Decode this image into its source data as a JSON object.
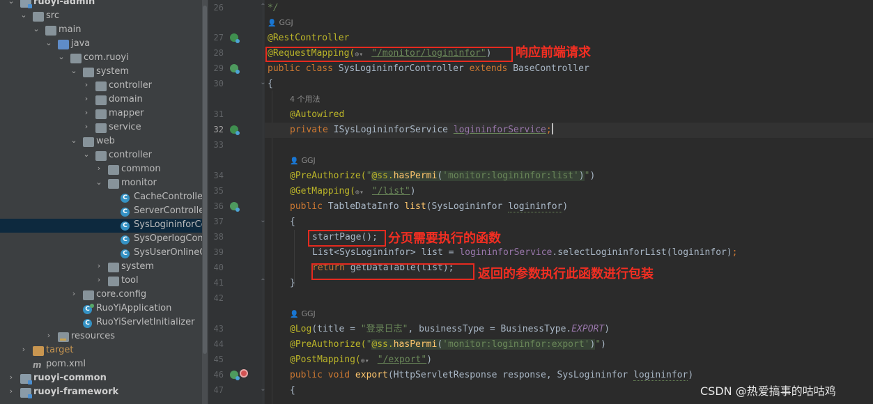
{
  "project_tree": {
    "rows": [
      {
        "label": "ruoyi-admin",
        "arrow": "expanded",
        "icon": "module-folder-icon",
        "bold": true
      },
      {
        "label": "src",
        "arrow": "expanded",
        "icon": "folder-icon"
      },
      {
        "label": "main",
        "arrow": "expanded",
        "icon": "folder-icon"
      },
      {
        "label": "java",
        "arrow": "expanded",
        "icon": "source-folder-icon"
      },
      {
        "label": "com.ruoyi",
        "arrow": "expanded",
        "icon": "package-icon"
      },
      {
        "label": "system",
        "arrow": "expanded",
        "icon": "package-icon"
      },
      {
        "label": "controller",
        "arrow": "collapsed",
        "icon": "package-icon"
      },
      {
        "label": "domain",
        "arrow": "collapsed",
        "icon": "package-icon"
      },
      {
        "label": "mapper",
        "arrow": "collapsed",
        "icon": "package-icon"
      },
      {
        "label": "service",
        "arrow": "collapsed",
        "icon": "package-icon"
      },
      {
        "label": "web",
        "arrow": "expanded",
        "icon": "package-icon"
      },
      {
        "label": "controller",
        "arrow": "expanded",
        "icon": "package-icon"
      },
      {
        "label": "common",
        "arrow": "collapsed",
        "icon": "package-icon"
      },
      {
        "label": "monitor",
        "arrow": "expanded",
        "icon": "package-icon"
      },
      {
        "label": "CacheController",
        "arrow": "none",
        "icon": "java-class-icon"
      },
      {
        "label": "ServerController",
        "arrow": "none",
        "icon": "java-class-icon"
      },
      {
        "label": "SysLogininforController",
        "arrow": "none",
        "icon": "java-class-icon",
        "selected": true
      },
      {
        "label": "SysOperlogController",
        "arrow": "none",
        "icon": "java-class-icon"
      },
      {
        "label": "SysUserOnlineController",
        "arrow": "none",
        "icon": "java-class-icon"
      },
      {
        "label": "system",
        "arrow": "collapsed",
        "icon": "package-icon"
      },
      {
        "label": "tool",
        "arrow": "collapsed",
        "icon": "package-icon"
      },
      {
        "label": "core.config",
        "arrow": "collapsed",
        "icon": "package-icon"
      },
      {
        "label": "RuoYiApplication",
        "arrow": "none",
        "icon": "spring-app-class-icon"
      },
      {
        "label": "RuoYiServletInitializer",
        "arrow": "none",
        "icon": "java-class-icon"
      },
      {
        "label": "resources",
        "arrow": "collapsed",
        "icon": "resources-folder-icon"
      },
      {
        "label": "target",
        "arrow": "collapsed",
        "icon": "excluded-folder-icon",
        "target": true
      },
      {
        "label": "pom.xml",
        "arrow": "none",
        "icon": "maven-icon"
      },
      {
        "label": "ruoyi-common",
        "arrow": "collapsed",
        "icon": "module-folder-icon",
        "bold": true
      },
      {
        "label": "ruoyi-framework",
        "arrow": "collapsed",
        "icon": "module-folder-icon",
        "bold": true
      }
    ]
  },
  "editor": {
    "line_numbers": [
      "26",
      "27",
      "28",
      "29",
      "30",
      "31",
      "32",
      "33",
      "34",
      "35",
      "36",
      "37",
      "38",
      "39",
      "40",
      "41",
      "42",
      "43",
      "44",
      "45",
      "46",
      "47"
    ],
    "current_line": "32",
    "hints": {
      "author": "GGJ",
      "usages": "4 个用法"
    },
    "code": {
      "l26": "*/",
      "l27_ann": "@RestController",
      "l28_ann": "@RequestMapping(",
      "l28_url": "\"/monitor/logininfor\"",
      "l28_close": ")",
      "l29_kw": "public class ",
      "l29_name": "SysLogininforController ",
      "l29_kw2": "extends ",
      "l29_base": "BaseController",
      "l30": "{",
      "l31_ann": "@Autowired",
      "l32_kw": "private ",
      "l32_type": "ISysLogininforService ",
      "l32_fld": "logininforService",
      "l32_semi": ";",
      "l34_ann": "@PreAuthorize(",
      "l34_q1": "\"",
      "l34_inj1": "@ss.",
      "l34_inj2": "hasPermi",
      "l34_inj3": "(",
      "l34_inj4": "'monitor:logininfor:list'",
      "l34_inj5": ")",
      "l34_q2": "\"",
      "l34_close": ")",
      "l35_ann": "@GetMapping(",
      "l35_url": "\"/list\"",
      "l35_close": ")",
      "l36_kw": "public ",
      "l36_type": "TableDataInfo ",
      "l36_fn": "list",
      "l36_args": "(SysLogininfor ",
      "l36_param": "logininfor",
      "l36_close": ")",
      "l37": "{",
      "l38": "startPage();",
      "l39_a": "List<SysLogininfor> list = ",
      "l39_fld": "logininforService",
      "l39_b": ".selectLogininforList(logininfor)",
      "l39_semi": ";",
      "l40_kw": "return ",
      "l40_rest": "getDataTable(list);",
      "l41": "}",
      "l43_ann": "@Log",
      "l43_a": "(title = ",
      "l43_str": "\"登录日志\"",
      "l43_b": ", businessType = BusinessType.",
      "l43_enum": "EXPORT",
      "l43_close": ")",
      "l44_ann": "@PreAuthorize(",
      "l44_q1": "\"",
      "l44_inj1": "@ss.",
      "l44_inj2": "hasPermi",
      "l44_inj3": "(",
      "l44_inj4": "'monitor:logininfor:export'",
      "l44_inj5": ")",
      "l44_q2": "\"",
      "l44_close": ")",
      "l45_ann": "@PostMapping(",
      "l45_url": "\"/export\"",
      "l45_close": ")",
      "l46_kw": "public void ",
      "l46_fn": "export",
      "l46_args": "(HttpServletResponse response, SysLogininfor ",
      "l46_param": "logininfor",
      "l46_close": ")",
      "l47": "{"
    }
  },
  "annotations": {
    "request_mapping_note": "响应前端请求",
    "start_page_note": "分页需要执行的函数",
    "return_note": "返回的参数执行此函数进行包装"
  },
  "watermark": "CSDN @热爱搞事的咕咕鸡",
  "colors": {
    "annotation_red": "#e52a1f",
    "keyword": "#cc7832",
    "annotation": "#bbb529",
    "string": "#6a8759",
    "field": "#9876aa",
    "method": "#ffc66d"
  }
}
